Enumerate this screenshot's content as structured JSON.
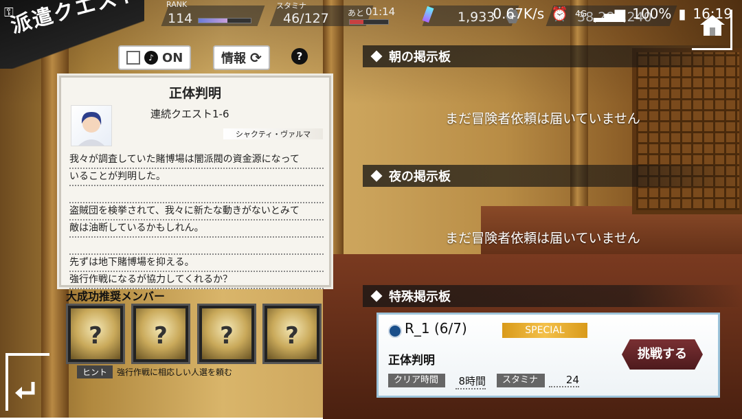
{
  "statusbar": {
    "net": "0.67K/s",
    "battery": "100%",
    "time": "16:19",
    "lte": "4G"
  },
  "title": "派遣クエスト",
  "hud": {
    "rank_label": "RANK",
    "rank_value": "114",
    "stamina_label": "スタミナ",
    "stamina_value": "46/127",
    "timer_label": "あと",
    "timer_value": "01:14",
    "gems": "1,933",
    "gold_partial": "38,283,240",
    "rank_progress": 0.55,
    "stamina_progress": 0.36
  },
  "toggles": {
    "notify_label": "ON",
    "info_label": "情報",
    "help": "?"
  },
  "quest": {
    "title": "正体判明",
    "subtitle": "連続クエスト1-6",
    "character": "シャクティ・ヴァルマ",
    "lines": [
      "我々が調査していた賭博場は闇派閥の資金源になって",
      "いることが判明した。",
      "",
      "盗賊団を検挙されて、我々に新たな動きがないとみて",
      "敵は油断しているかもしれん。",
      "",
      "先ずは地下賭博場を抑える。",
      "強行作戦になるが協力してくれるか？"
    ]
  },
  "recommend": {
    "title": "大成功推奨メンバー",
    "slots": [
      "?",
      "?",
      "?",
      "?"
    ],
    "hint_tag": "ヒント",
    "hint_text": "強行作戦に相応しい人選を頼む"
  },
  "boards": {
    "morning": {
      "title": "朝の掲示板",
      "empty": "まだ冒険者依頼は届いていません"
    },
    "night": {
      "title": "夜の掲示板",
      "empty": "まだ冒険者依頼は届いていません"
    },
    "special": {
      "title": "特殊掲示板"
    }
  },
  "special_quest": {
    "code": "R_1 (6/7)",
    "badge": "SPECIAL",
    "name": "正体判明",
    "clear_time_label": "クリア時間",
    "clear_time_value": "8時間",
    "stamina_label": "スタミナ",
    "stamina_value": "24",
    "challenge_label": "挑戦する"
  },
  "colors": {
    "accent_special": "#f3c04a",
    "card_border": "#9cc3da",
    "challenge_btn": "#6b272a"
  }
}
